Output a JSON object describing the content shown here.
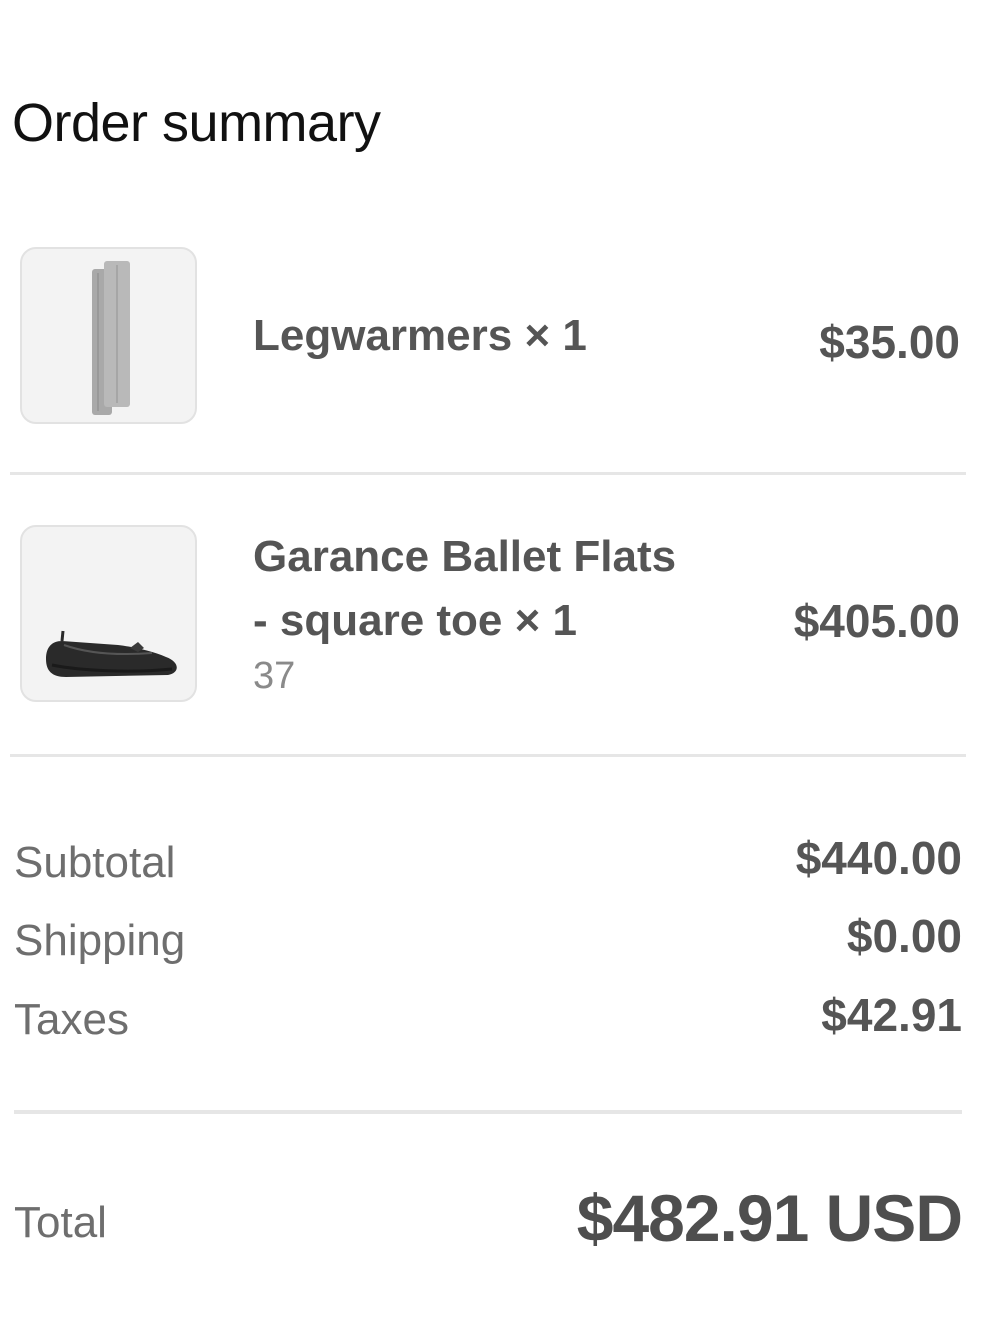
{
  "page": {
    "title": "Order summary"
  },
  "items": [
    {
      "name_lines": [
        "Legwarmers × 1"
      ],
      "variant": "",
      "price": "$35.00",
      "image_icon": "legwarmers-product-image"
    },
    {
      "name_lines": [
        "Garance Ballet Flats",
        "- square toe × 1"
      ],
      "variant": "37",
      "price": "$405.00",
      "image_icon": "ballet-flat-product-image"
    }
  ],
  "summary": {
    "subtotal_label": "Subtotal",
    "subtotal_value": "$440.00",
    "shipping_label": "Shipping",
    "shipping_value": "$0.00",
    "taxes_label": "Taxes",
    "taxes_value": "$42.91"
  },
  "total": {
    "label": "Total",
    "value": "$482.91 USD"
  },
  "colors": {
    "text_primary": "#111111",
    "text_secondary": "#555555",
    "text_muted": "#8a8a8a",
    "divider": "#e6e6e6",
    "thumb_background": "#f3f3f3"
  }
}
